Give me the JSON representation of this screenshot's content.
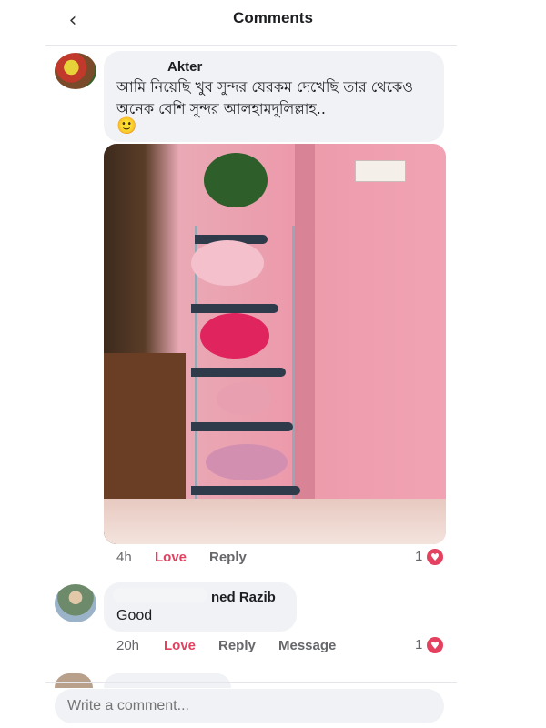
{
  "header": {
    "back_icon": "chevron-left-icon",
    "title": "Comments"
  },
  "comments": [
    {
      "author": "Akter",
      "text": "আমি নিয়েছি খুব সুন্দর যেরকম দেখেছি তার থেকেও অনেক বেশি সুন্দর আলহামদুলিল্লাহ..",
      "emoji": "🙂",
      "time": "4h",
      "love_label": "Love",
      "reply_label": "Reply",
      "reaction_count": "1"
    },
    {
      "author": "ned Razib",
      "text": "Good",
      "time": "20h",
      "love_label": "Love",
      "reply_label": "Reply",
      "message_label": "Message",
      "reaction_count": "1"
    }
  ],
  "composer": {
    "placeholder": "Write a comment..."
  },
  "colors": {
    "love": "#e4405f",
    "bubble": "#f0f2f5",
    "muted": "#65676b"
  }
}
